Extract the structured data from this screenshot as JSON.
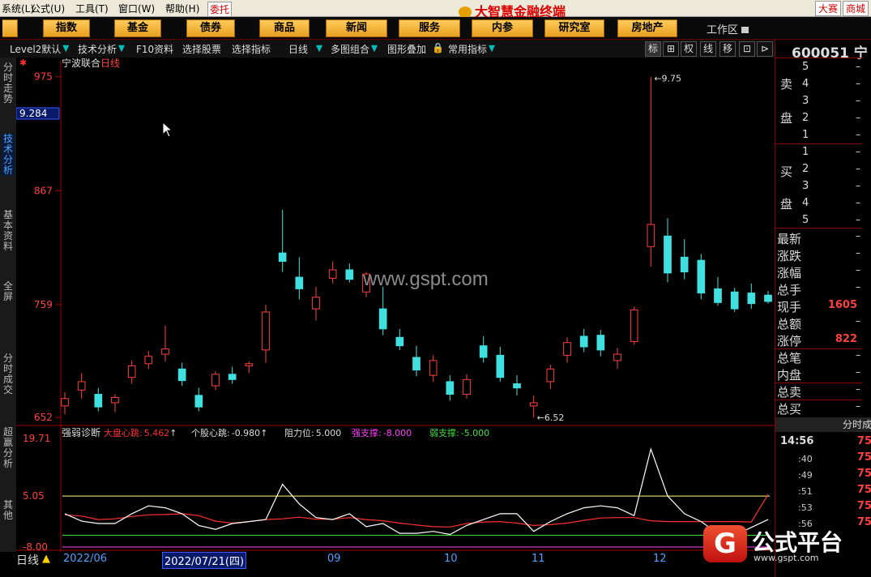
{
  "menu": {
    "items": [
      "系统(L)",
      "公式(U)",
      "工具(T)",
      "窗口(W)",
      "帮助(H)"
    ],
    "weituo": "委托",
    "app_title": "大智慧金融终端",
    "right_buttons": [
      "大赛",
      "商城"
    ]
  },
  "tabs": [
    "指数",
    "基金",
    "债券",
    "商品",
    "新闻",
    "服务",
    "内参",
    "研究室",
    "房地产"
  ],
  "workspace": "工作区",
  "toolbar": {
    "items": [
      "Level2默认",
      "技术分析",
      "F10资料",
      "选择股票",
      "选择指标",
      "日线",
      "多图组合",
      "图形叠加",
      "常用指标"
    ],
    "buttons": [
      "标",
      "权",
      "线",
      "移"
    ]
  },
  "left_nav": [
    "分时走势",
    "技术分析",
    "基本资料",
    "全屏",
    "分时成交",
    "超赢分析",
    "其他"
  ],
  "price_chart": {
    "title": "宁波联合",
    "period": "日线",
    "y_labels": [
      "975",
      "867",
      "759",
      "652"
    ],
    "cursor_value": "9.284",
    "high_label": "9.75",
    "low_label": "6.52",
    "watermark": "www.gspt.com"
  },
  "chart_data": [
    {
      "type": "candlestick",
      "title": "宁波联合 日线",
      "ylim": [
        6.46,
        9.84
      ],
      "y_ticks": [
        9.75,
        8.67,
        7.59,
        6.52
      ],
      "max": 9.75,
      "min": 6.52,
      "ohlc_sampled": [
        [
          6.63,
          6.76,
          6.55,
          6.7
        ],
        [
          6.78,
          6.94,
          6.7,
          6.86
        ],
        [
          6.74,
          6.8,
          6.58,
          6.62
        ],
        [
          6.66,
          6.74,
          6.57,
          6.71
        ],
        [
          6.9,
          7.06,
          6.84,
          7.01
        ],
        [
          7.03,
          7.15,
          6.98,
          7.1
        ],
        [
          7.12,
          7.39,
          7.05,
          7.17
        ],
        [
          6.98,
          7.04,
          6.82,
          6.87
        ],
        [
          6.73,
          6.8,
          6.58,
          6.62
        ],
        [
          6.82,
          6.96,
          6.78,
          6.93
        ],
        [
          6.93,
          7.0,
          6.84,
          6.88
        ],
        [
          7.01,
          7.05,
          6.94,
          7.03
        ],
        [
          7.16,
          7.59,
          7.04,
          7.52
        ],
        [
          8.08,
          8.49,
          7.9,
          8.0
        ],
        [
          7.85,
          8.04,
          7.64,
          7.74
        ],
        [
          7.55,
          7.76,
          7.44,
          7.66
        ],
        [
          7.84,
          8.0,
          7.79,
          7.92
        ],
        [
          7.92,
          7.98,
          7.8,
          7.83
        ],
        [
          7.71,
          7.9,
          7.66,
          7.88
        ],
        [
          7.55,
          7.76,
          7.3,
          7.36
        ],
        [
          7.28,
          7.36,
          7.16,
          7.2
        ],
        [
          7.09,
          7.2,
          6.91,
          6.97
        ],
        [
          6.92,
          7.11,
          6.86,
          7.06
        ],
        [
          6.86,
          6.92,
          6.68,
          6.74
        ],
        [
          6.74,
          6.93,
          6.7,
          6.88
        ],
        [
          7.2,
          7.29,
          7.04,
          7.09
        ],
        [
          7.11,
          7.19,
          6.86,
          6.9
        ],
        [
          6.84,
          6.92,
          6.73,
          6.8
        ],
        [
          6.63,
          6.73,
          6.52,
          6.66
        ],
        [
          6.86,
          7.02,
          6.79,
          6.98
        ],
        [
          7.11,
          7.28,
          7.04,
          7.23
        ],
        [
          7.29,
          7.36,
          7.14,
          7.19
        ],
        [
          7.3,
          7.35,
          7.1,
          7.16
        ],
        [
          7.06,
          7.18,
          6.98,
          7.12
        ],
        [
          7.24,
          7.57,
          7.21,
          7.54
        ],
        [
          8.14,
          9.75,
          7.95,
          8.35
        ],
        [
          8.24,
          8.41,
          7.8,
          7.89
        ],
        [
          8.04,
          8.21,
          7.83,
          7.9
        ],
        [
          8.01,
          8.07,
          7.64,
          7.7
        ],
        [
          7.74,
          7.85,
          7.58,
          7.61
        ],
        [
          7.71,
          7.75,
          7.52,
          7.55
        ],
        [
          7.7,
          7.79,
          7.55,
          7.6
        ],
        [
          7.68,
          7.72,
          7.6,
          7.62
        ]
      ],
      "ohlc_note_seq": "sampled at roughly 7-day intervals from the visible window"
    },
    {
      "type": "line",
      "title": "强弱诊断",
      "ylim": [
        -8.0,
        19.71
      ],
      "y_ticks": [
        19.71,
        5.05,
        -8.0
      ],
      "series": [
        {
          "name": "大盘心跳",
          "color": "#ff3030",
          "last": 5.462,
          "values": [
            0.2,
            -0.1,
            -1.0,
            -0.8,
            -0.2,
            0.2,
            0.3,
            0.5,
            0.0,
            -1.4,
            -1.9,
            -1.5,
            -1.0,
            -0.8,
            -0.4,
            -0.9,
            -0.9,
            -0.5,
            -1.0,
            -1.3,
            -1.9,
            -2.4,
            -2.8,
            -2.9,
            -2.0,
            -1.6,
            -1.5,
            -1.9,
            -2.5,
            -2.3,
            -1.9,
            -1.2,
            -0.6,
            -0.5,
            -0.5,
            -1.3,
            -1.5,
            -1.5,
            -1.5,
            -1.5,
            -1.5,
            -1.6,
            5.4
          ]
        },
        {
          "name": "个股心跳",
          "color": "#ffffff",
          "last": -0.98,
          "values": [
            0.5,
            -1.4,
            -2.0,
            -2.0,
            0.5,
            2.5,
            2.0,
            0.5,
            -2.5,
            -3.5,
            -2.0,
            -1.5,
            -1.0,
            8.0,
            3.0,
            -0.5,
            -1.0,
            0.5,
            -2.8,
            -2.0,
            -4.5,
            -4.5,
            -4.0,
            -4.8,
            -2.5,
            -1.0,
            0.5,
            0.5,
            -4.0,
            -1.5,
            0.5,
            2.0,
            2.5,
            2.0,
            0.0,
            17.0,
            5.0,
            0.5,
            -1.5,
            -4.5,
            -5.0,
            -3.0,
            -0.98
          ]
        }
      ],
      "resistance": 5.0,
      "strong_support": -8.0,
      "weak_support": -5.0
    }
  ],
  "indicator": {
    "name": "强弱诊断",
    "market_label": "大盘心跳:",
    "market_value": "5.462",
    "stock_label": "个股心跳:",
    "stock_value": "-0.980",
    "resistance_label": "阻力位:",
    "resistance_value": "5.000",
    "strong_label": "强支撑:",
    "strong_value": "-8.000",
    "weak_label": "弱支撑:",
    "weak_value": "-5.000",
    "y_labels": [
      "19.71",
      "5.05",
      "-8.00"
    ]
  },
  "bottom": {
    "period": "日线",
    "months": [
      "2022/06",
      "09",
      "10",
      "11",
      "12"
    ],
    "date_box": "2022/07/21(四)"
  },
  "quote_panel": {
    "code": "600051",
    "name": "宁",
    "sell_label": [
      "卖",
      "盘"
    ],
    "buy_label": [
      "买",
      "盘"
    ],
    "sell_levels": [
      "5",
      "4",
      "3",
      "2",
      "1"
    ],
    "buy_levels": [
      "1",
      "2",
      "3",
      "4",
      "5"
    ],
    "dash": "–",
    "fields": [
      "最新",
      "涨跌",
      "涨幅",
      "总手",
      "现手",
      "总额",
      "涨停",
      "总笔",
      "内盘",
      "总卖",
      "总买"
    ],
    "now_hand": "1605",
    "limit_up": "822",
    "ticks_header": "分时成",
    "ticks_times": [
      "14:56",
      ":40",
      ":49",
      ":51",
      ":53",
      ":56"
    ],
    "ticks_prices": [
      "75",
      "75",
      "75",
      "75",
      "75",
      "75"
    ]
  },
  "brand": {
    "glyph": "G",
    "name": "公式平台",
    "url": "www.gspt.com"
  },
  "colors": {
    "up": "#ff4040",
    "down": "#40e0e0",
    "resistance": "#ffff80",
    "strong_support": "#ff40ff",
    "weak_support": "#40e040",
    "frame": "#a00000"
  }
}
